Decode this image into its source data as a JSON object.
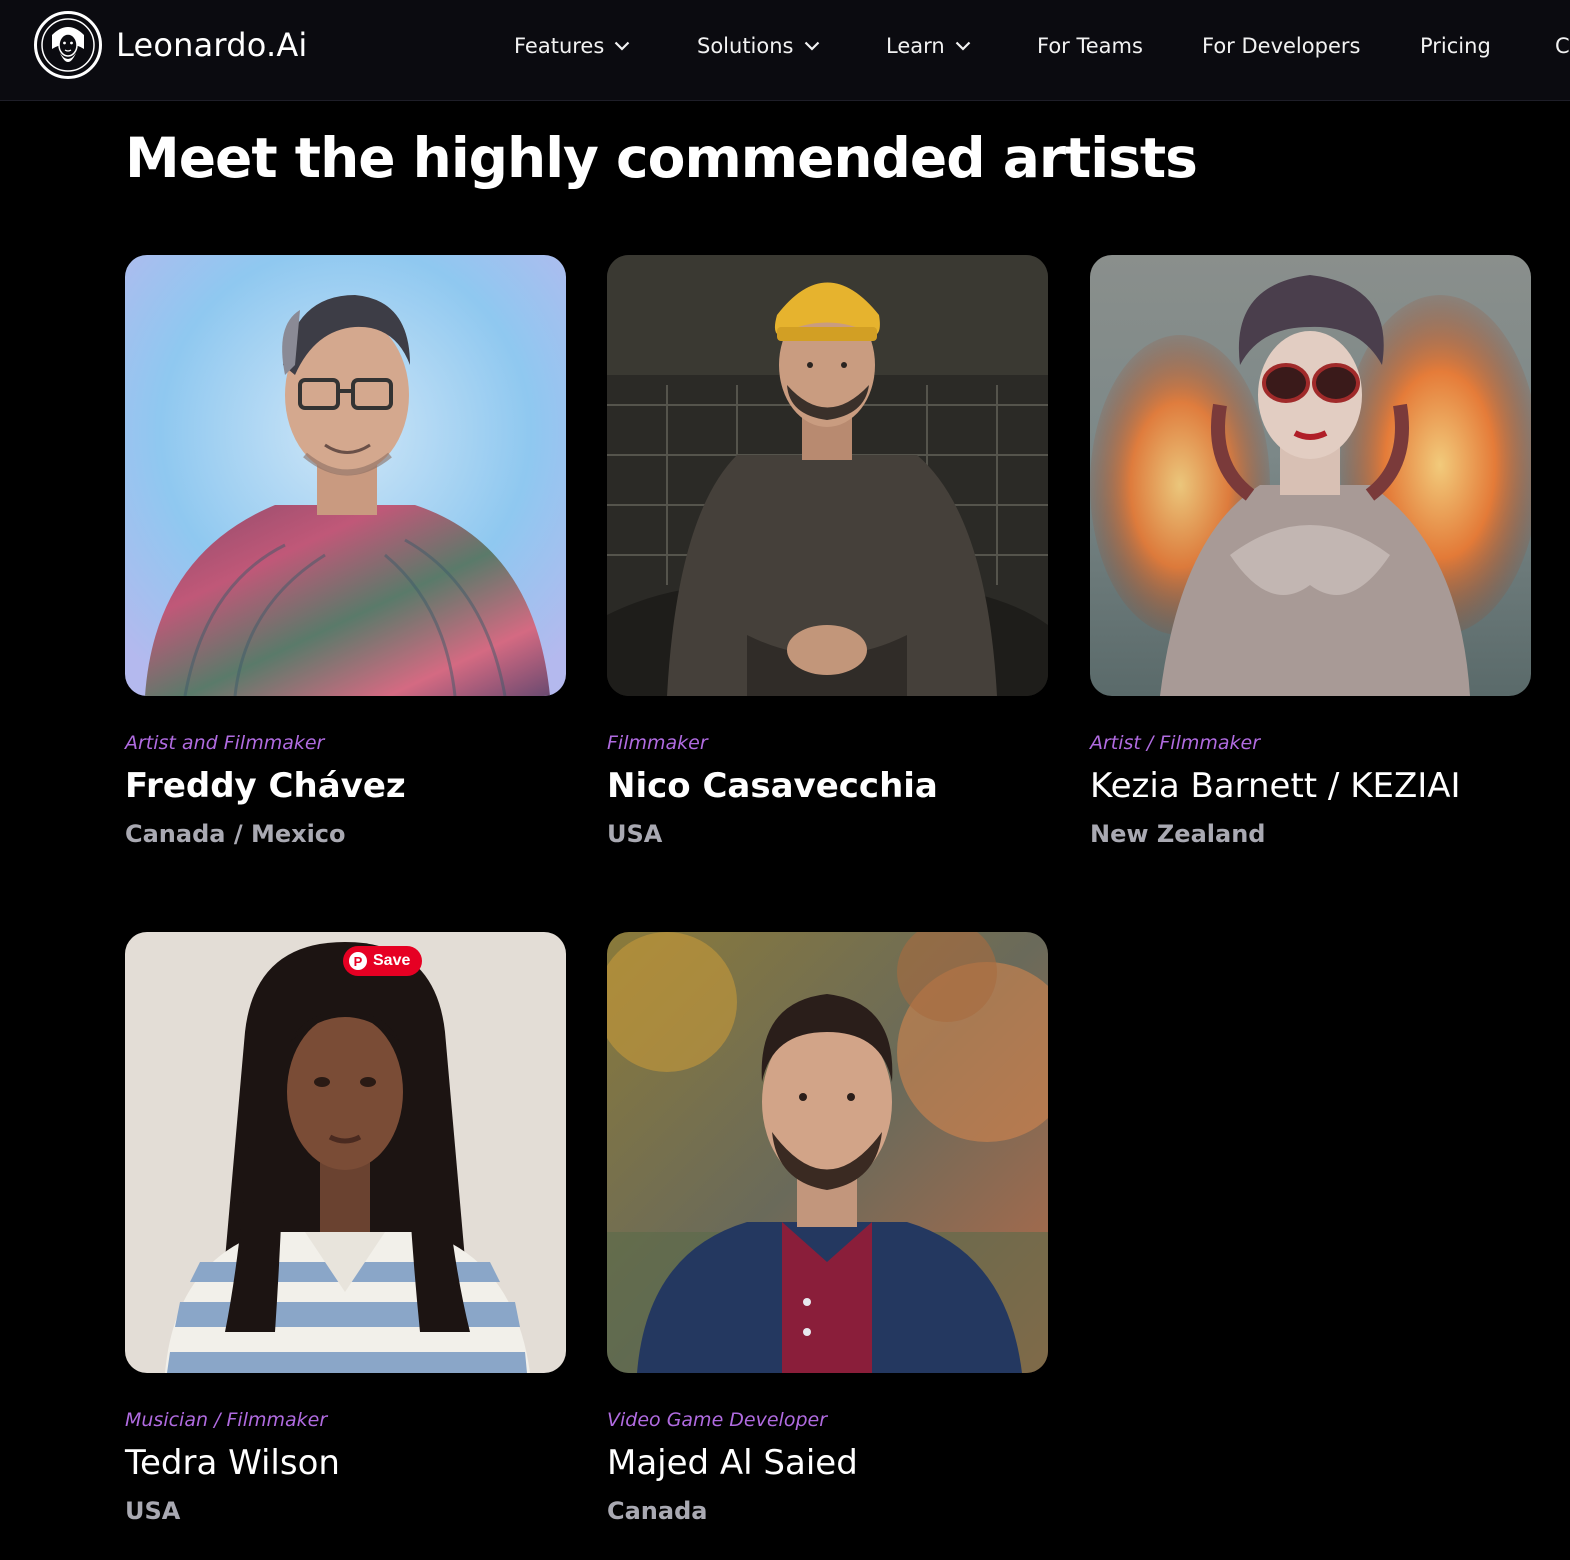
{
  "brand": {
    "name": "Leonardo.Ai",
    "logo_icon": "leonardo-face-logo-icon"
  },
  "nav": {
    "items": [
      {
        "label": "Features",
        "has_dropdown": true
      },
      {
        "label": "Solutions",
        "has_dropdown": true
      },
      {
        "label": "Learn",
        "has_dropdown": true
      },
      {
        "label": "For Teams",
        "has_dropdown": false
      },
      {
        "label": "For Developers",
        "has_dropdown": false
      },
      {
        "label": "Pricing",
        "has_dropdown": false
      },
      {
        "label": "C",
        "has_dropdown": false
      }
    ]
  },
  "section": {
    "title": "Meet the highly commended artists"
  },
  "artists": [
    {
      "role": "Artist and Filmmaker",
      "name": "Freddy Chávez",
      "country": "Canada / Mexico"
    },
    {
      "role": "Filmmaker",
      "name": "Nico Casavecchia",
      "country": "USA"
    },
    {
      "role": "Artist / Filmmaker",
      "name": "Kezia Barnett / KEZIAI",
      "country": "New Zealand"
    },
    {
      "role": "Musician / Filmmaker",
      "name": "Tedra Wilson",
      "country": "USA"
    },
    {
      "role": "Video Game Developer",
      "name": "Majed Al Saied",
      "country": "Canada"
    }
  ],
  "pinterest": {
    "save_label": "Save",
    "icon": "pinterest-icon",
    "glyph": "P"
  },
  "colors": {
    "background": "#000000",
    "nav_background": "#0b0b10",
    "role_accent": "#b06be0",
    "country_text": "#a9a9b2",
    "pinterest_red": "#e60023"
  }
}
